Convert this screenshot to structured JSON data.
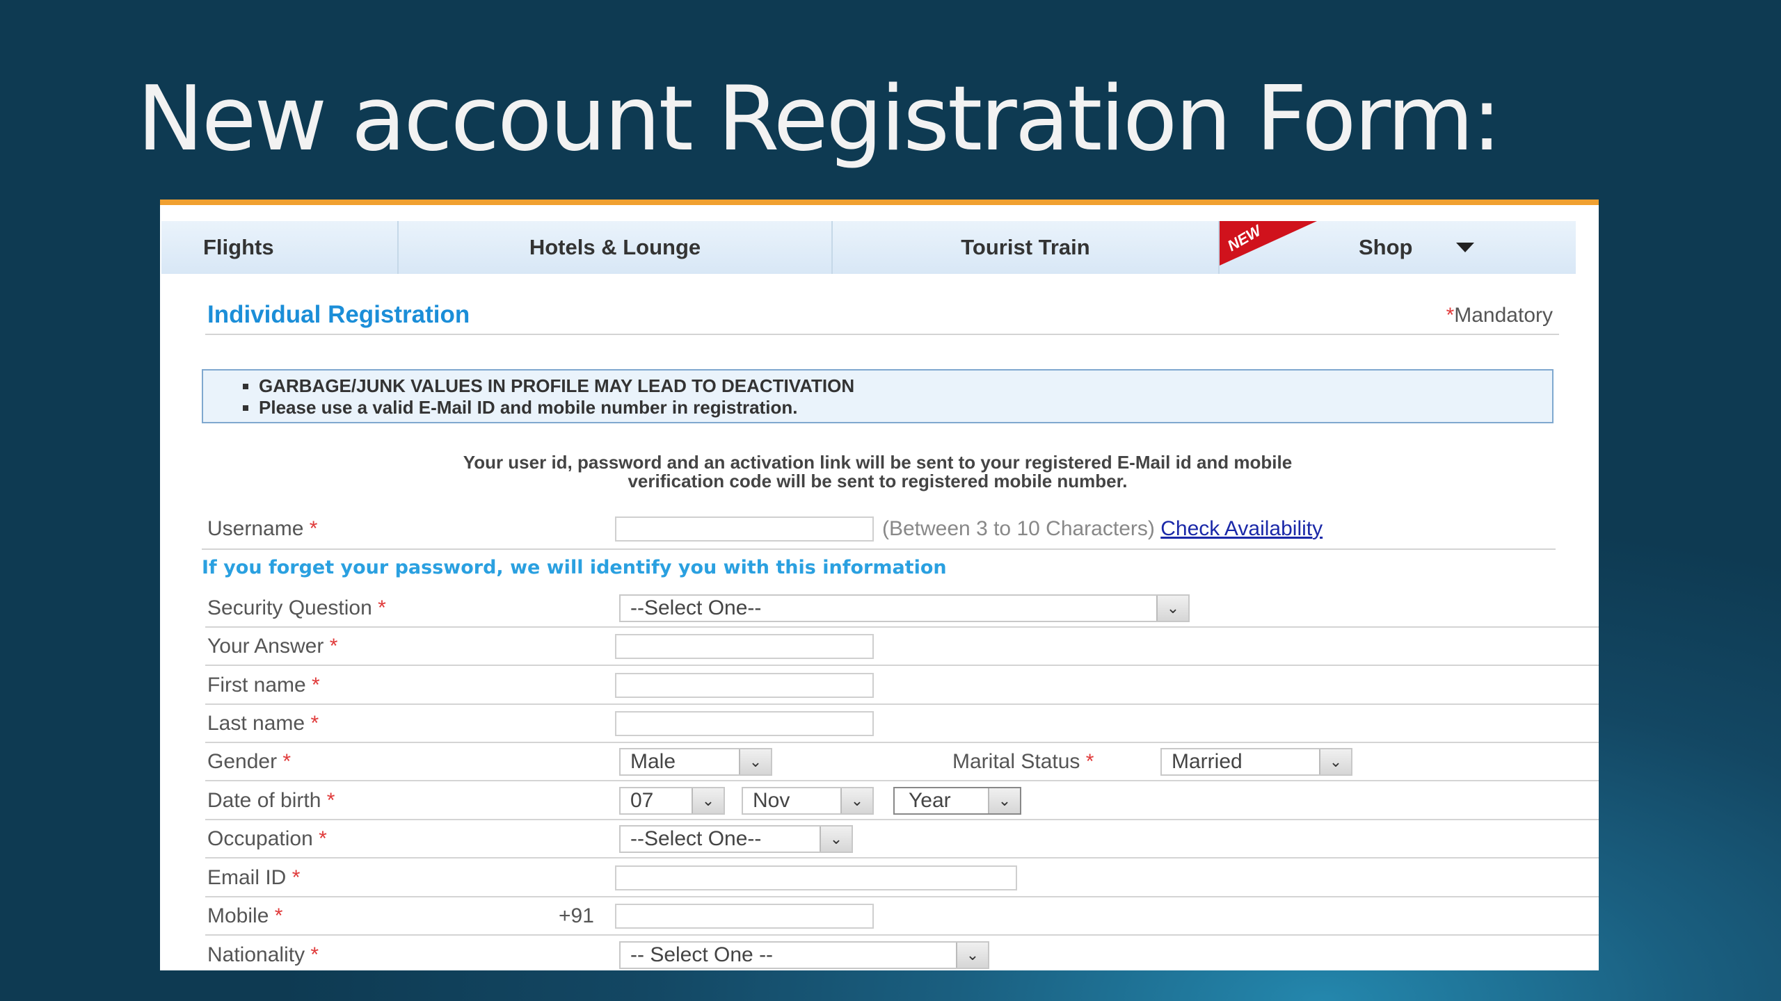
{
  "slide": {
    "title": "New account Registration Form:"
  },
  "nav": {
    "tabs": [
      {
        "label": "Flights"
      },
      {
        "label": "Hotels & Lounge"
      },
      {
        "label": "Tourist Train"
      },
      {
        "label": "Shop",
        "badge": "NEW"
      }
    ]
  },
  "form": {
    "heading": "Individual Registration",
    "mandatory_star": "*",
    "mandatory_label": "Mandatory",
    "notices": [
      "GARBAGE/JUNK VALUES IN PROFILE MAY LEAD TO DEACTIVATION",
      "Please use a valid E-Mail ID and mobile number in registration."
    ],
    "info_line1": "Your user id, password and an activation link will be sent to your registered E-Mail id and mobile",
    "info_line2": "verification code will be sent to registered mobile number.",
    "username": {
      "label": "Username",
      "value": "",
      "hint": "(Between 3 to 10 Characters)",
      "link": "Check Availability"
    },
    "recovery_note": "If you forget your password, we will identify you with this information",
    "security_question": {
      "label": "Security Question",
      "selected": "--Select One--"
    },
    "answer": {
      "label": "Your Answer",
      "value": ""
    },
    "first_name": {
      "label": "First name",
      "value": ""
    },
    "last_name": {
      "label": "Last name",
      "value": ""
    },
    "gender": {
      "label": "Gender",
      "selected": "Male"
    },
    "marital_status": {
      "label": "Marital Status",
      "selected": "Married"
    },
    "dob": {
      "label": "Date of birth",
      "day": "07",
      "month": "Nov",
      "year": "Year"
    },
    "occupation": {
      "label": "Occupation",
      "selected": "--Select One--"
    },
    "email": {
      "label": "Email ID",
      "value": ""
    },
    "mobile": {
      "label": "Mobile",
      "prefix": "+91",
      "value": ""
    },
    "nationality": {
      "label": "Nationality",
      "selected": "-- Select One --"
    },
    "required_marker": "*",
    "dropdown_glyph": "⌄"
  }
}
